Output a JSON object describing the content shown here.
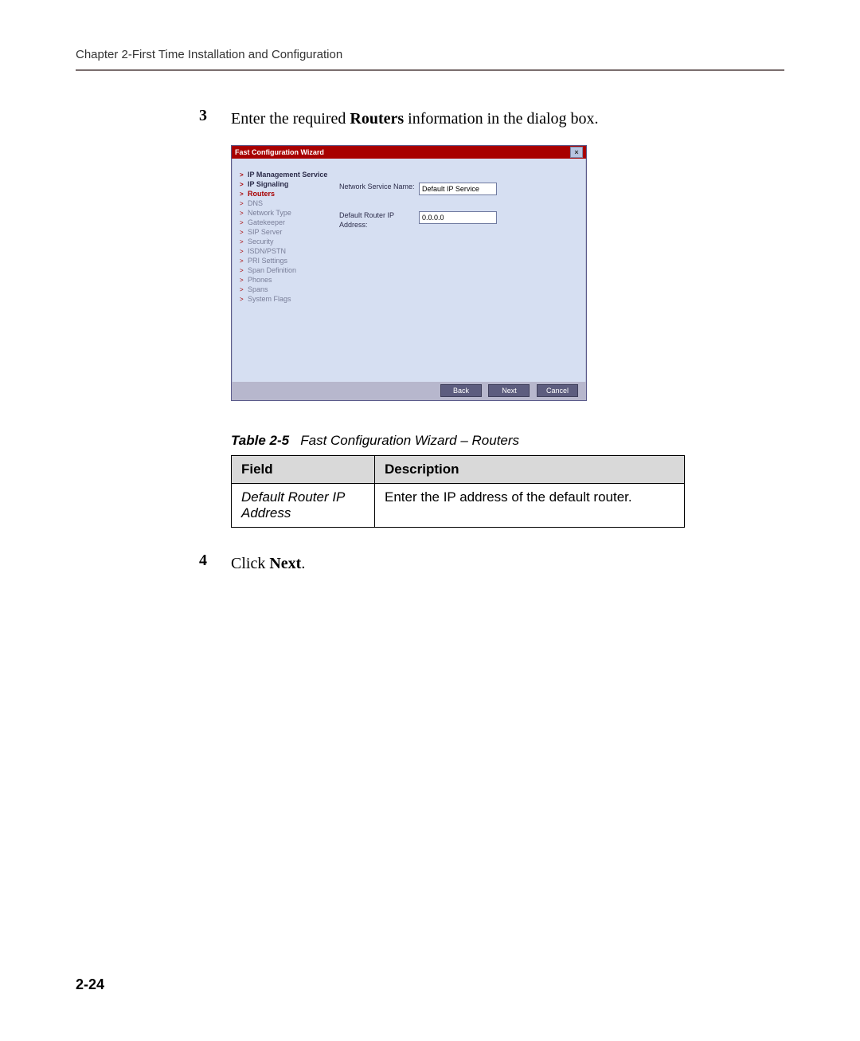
{
  "header": {
    "chapter": "Chapter 2-First Time Installation and Configuration"
  },
  "steps": {
    "s3": {
      "num": "3",
      "prefix": "Enter the required ",
      "bold": "Routers",
      "suffix": " information in the dialog box."
    },
    "s4": {
      "num": "4",
      "prefix": "Click ",
      "bold": "Next",
      "suffix": "."
    }
  },
  "wizard": {
    "title": "Fast Configuration Wizard",
    "nav": {
      "n0": "IP Management Service",
      "n1": "IP Signaling",
      "n2": "Routers",
      "n3": "DNS",
      "n4": "Network Type",
      "n5": "Gatekeeper",
      "n6": "SIP Server",
      "n7": "Security",
      "n8": "ISDN/PSTN",
      "n9": "PRI Settings",
      "n10": "Span Definition",
      "n11": "Phones",
      "n12": "Spans",
      "n13": "System Flags"
    },
    "form": {
      "row1_label": "Network Service Name:",
      "row1_value": "Default IP Service",
      "row2_label": "Default Router IP Address:",
      "row2_value": "0.0.0.0"
    },
    "buttons": {
      "back": "Back",
      "next": "Next",
      "cancel": "Cancel"
    }
  },
  "table": {
    "caption_bold": "Table 2-5",
    "caption_rest": "Fast Configuration Wizard – Routers",
    "h1": "Field",
    "h2": "Description",
    "r1c1": "Default Router IP Address",
    "r1c2": "Enter the IP address of the default router."
  },
  "pagenum": "2-24"
}
